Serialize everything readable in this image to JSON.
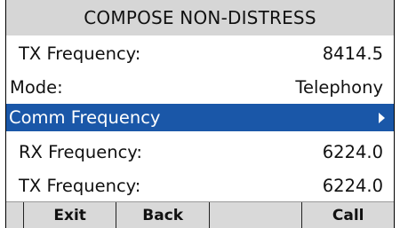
{
  "screen": {
    "title": "COMPOSE NON-DISTRESS"
  },
  "rows": [
    {
      "label": "TX Frequency:",
      "value": "8414.5"
    },
    {
      "label": "Mode:",
      "value": "Telephony"
    },
    {
      "label": "Comm Frequency",
      "value": ""
    },
    {
      "label": "RX Frequency:",
      "value": "6224.0"
    },
    {
      "label": "TX Frequency:",
      "value": "6224.0"
    }
  ],
  "softkeys": {
    "exit": "Exit",
    "back": "Back",
    "blank": "",
    "call": "Call"
  },
  "colors": {
    "title_bg": "#d6d6d6",
    "highlight_bg": "#1a57a8",
    "softkey_bg": "#d9d9d9"
  }
}
